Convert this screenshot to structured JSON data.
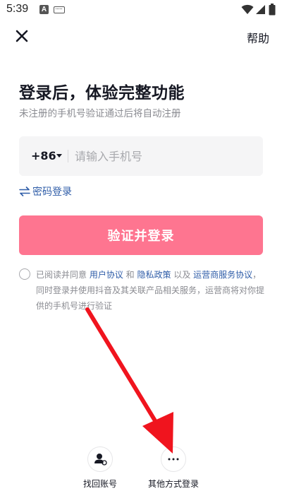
{
  "status_bar": {
    "time": "5:39",
    "a_badge": "A"
  },
  "header": {
    "help_label": "帮助"
  },
  "main": {
    "title": "登录后，体验完整功能",
    "subtitle": "未注册的手机号验证通过后将自动注册",
    "country_code": "+86",
    "phone_placeholder": "请输入手机号",
    "password_login_label": "密码登录",
    "login_button_label": "验证并登录"
  },
  "agreement": {
    "prefix": "已阅读并同意 ",
    "user_agreement": "用户协议",
    "and": " 和 ",
    "privacy_policy": "隐私政策",
    "and2": " 以及 ",
    "carrier_agreement": "运营商服务协议",
    "suffix": "，同时登录并使用抖音及其关联产品相关服务，运营商将对你提供的手机号进行验证"
  },
  "bottom": {
    "recover_label": "找回账号",
    "other_label": "其他方式登录"
  },
  "colors": {
    "accent_button": "#fe7590",
    "link": "#2f5da8",
    "arrow": "#f0141e"
  }
}
